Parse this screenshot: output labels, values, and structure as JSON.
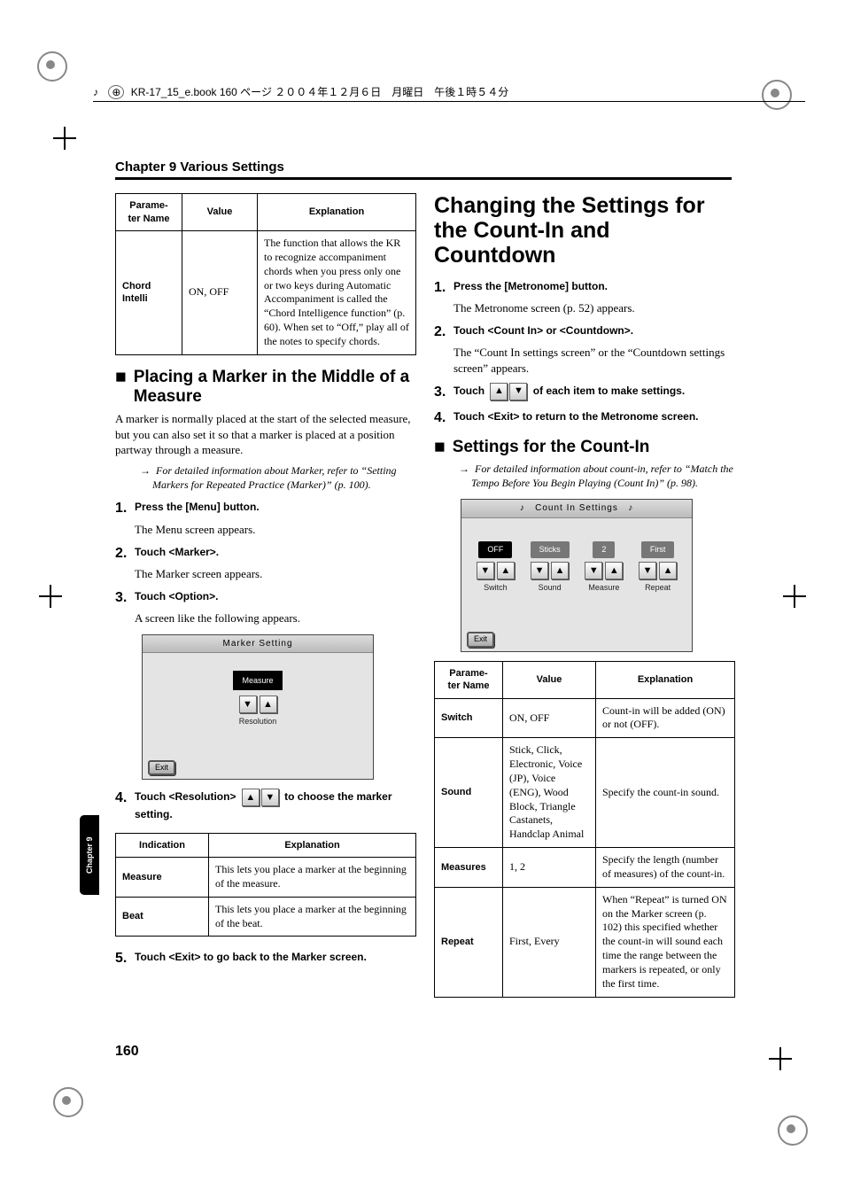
{
  "print_header": "KR-17_15_e.book  160 ページ  ２００４年１２月６日　月曜日　午後１時５４分",
  "running_head": "Chapter 9 Various Settings",
  "tab_label": "Chapter 9",
  "page_number": "160",
  "leftTable": {
    "headers": [
      "Parame-\nter Name",
      "Value",
      "Explanation"
    ],
    "rows": [
      {
        "param": "Chord Intelli",
        "value": "ON, OFF",
        "expl": "The function that allows the KR to recognize accompaniment chords when you press only one or two keys during Automatic Accompaniment is called the “Chord Intelligence function” (p. 60). When set to “Off,” play all of the notes to specify chords."
      }
    ]
  },
  "marker_section": {
    "title": "Placing a Marker in the Middle of a Measure",
    "intro": "A marker is normally placed at the start of the selected measure, but you can also set it so that a marker is placed at a position partway through a measure.",
    "note": "For detailed information about Marker, refer to “Setting Markers for Repeated Practice (Marker)” (p. 100).",
    "steps": [
      {
        "bold": "Press the [Menu] button.",
        "follow": "The Menu screen appears."
      },
      {
        "bold": "Touch <Marker>.",
        "follow": "The Marker screen appears."
      },
      {
        "bold": "Touch <Option>.",
        "follow": "A screen like the following appears."
      }
    ],
    "fig_title": "Marker Setting",
    "fig_measure": "Measure",
    "fig_resolution": "Resolution",
    "fig_exit": "Exit",
    "step4_a": "Touch <Resolution> ",
    "step4_b": " to choose the marker setting.",
    "indic_table": {
      "headers": [
        "Indication",
        "Explanation"
      ],
      "rows": [
        {
          "ind": "Measure",
          "expl": "This lets you place a marker at the beginning of the measure."
        },
        {
          "ind": "Beat",
          "expl": "This lets you place a marker at the beginning of the beat."
        }
      ]
    },
    "step5": "Touch <Exit> to go back to the Marker screen."
  },
  "count_section": {
    "title": "Changing the Settings for the Count-In and Countdown",
    "steps12": [
      {
        "bold": "Press the [Metronome] button.",
        "follow": "The Metronome screen (p. 52) appears."
      },
      {
        "bold": "Touch <Count In> or <Countdown>.",
        "follow": "The “Count In settings screen” or the “Countdown settings screen” appears."
      }
    ],
    "step3_a": "Touch ",
    "step3_b": " of each item to make settings.",
    "step4": "Touch <Exit> to return to the Metronome screen.",
    "sub_title": "Settings for the Count-In",
    "sub_note": "For detailed information about count-in, refer to “Match the Tempo Before You Begin Playing (Count In)” (p. 98).",
    "fig_title": "Count In Settings",
    "fig": {
      "cols": [
        {
          "value": "OFF",
          "label": "Switch"
        },
        {
          "value": "Sticks",
          "label": "Sound"
        },
        {
          "value": "2",
          "label": "Measure"
        },
        {
          "value": "First",
          "label": "Repeat"
        }
      ],
      "exit": "Exit"
    },
    "param_table": {
      "headers": [
        "Parame-\nter Name",
        "Value",
        "Explanation"
      ],
      "rows": [
        {
          "param": "Switch",
          "value": "ON, OFF",
          "expl": "Count-in will be added (ON) or not (OFF)."
        },
        {
          "param": "Sound",
          "value": "Stick, Click, Electronic, Voice (JP), Voice (ENG), Wood Block, Triangle Castanets, Handclap Animal",
          "expl": "Specify the count-in sound."
        },
        {
          "param": "Measures",
          "value": "1, 2",
          "expl": "Specify the length (number of measures) of the count-in."
        },
        {
          "param": "Repeat",
          "value": "First, Every",
          "expl": "When “Repeat” is turned ON on the Marker screen (p. 102) this specified whether the count-in will sound each time the range between the markers is repeated, or only the first time."
        }
      ]
    }
  }
}
